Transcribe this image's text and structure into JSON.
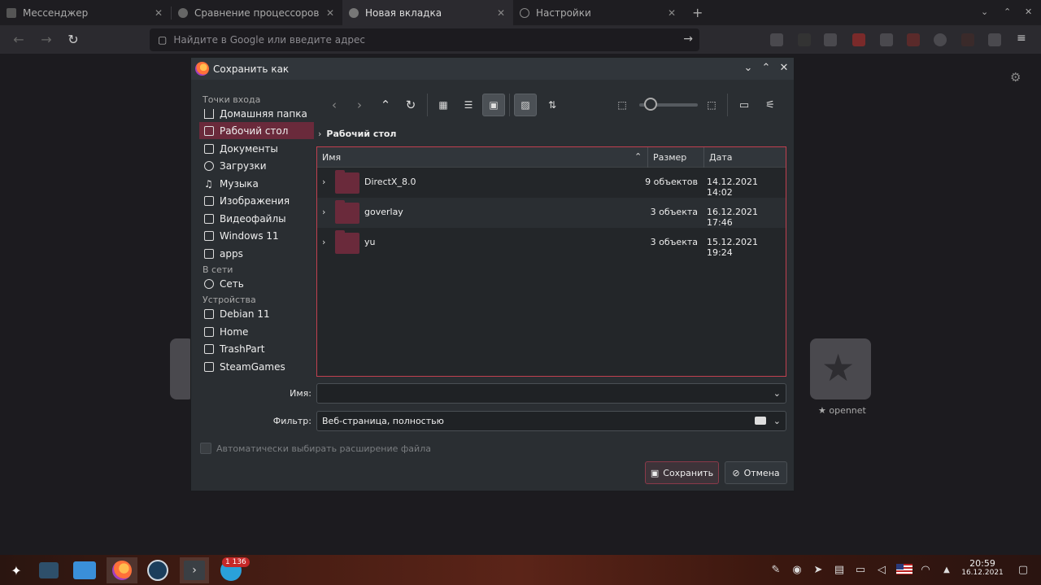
{
  "browser": {
    "tabs": [
      {
        "label": "Мессенджер"
      },
      {
        "label": "Сравнение процессоров"
      },
      {
        "label": "Новая вкладка"
      },
      {
        "label": "Настройки"
      }
    ],
    "url_placeholder": "Найдите в Google или введите адрес"
  },
  "page": {
    "tile_label": "★ opennet"
  },
  "dialog": {
    "title": "Сохранить как",
    "sidebar": {
      "section_places": "Точки входа",
      "places": [
        {
          "label": "Домашняя папка",
          "icon": "home-icon"
        },
        {
          "label": "Рабочий стол",
          "icon": "desktop-icon"
        },
        {
          "label": "Документы",
          "icon": "documents-icon"
        },
        {
          "label": "Загрузки",
          "icon": "downloads-icon"
        },
        {
          "label": "Музыка",
          "icon": "music-icon"
        },
        {
          "label": "Изображения",
          "icon": "pictures-icon"
        },
        {
          "label": "Видеофайлы",
          "icon": "videos-icon"
        },
        {
          "label": "Windows 11",
          "icon": "trash-icon"
        },
        {
          "label": "apps",
          "icon": "folder-icon"
        }
      ],
      "section_network": "В сети",
      "network": [
        {
          "label": "Сеть",
          "icon": "network-icon"
        }
      ],
      "section_devices": "Устройства",
      "devices": [
        {
          "label": "Debian 11",
          "icon": "drive-icon"
        },
        {
          "label": "Home",
          "icon": "drive-icon"
        },
        {
          "label": "TrashPart",
          "icon": "drive-icon"
        },
        {
          "label": "SteamGames",
          "icon": "drive-icon"
        }
      ]
    },
    "breadcrumb": "Рабочий стол",
    "columns": {
      "name": "Имя",
      "size": "Размер",
      "date": "Дата"
    },
    "files": [
      {
        "name": "DirectX_8.0",
        "size": "9 объектов",
        "date": "14.12.2021 14:02"
      },
      {
        "name": "goverlay",
        "size": "3 объекта",
        "date": "16.12.2021 17:46"
      },
      {
        "name": "yu",
        "size": "3 объекта",
        "date": "15.12.2021 19:24"
      }
    ],
    "name_label": "Имя:",
    "name_value": "",
    "filter_label": "Фильтр:",
    "filter_value": "Веб-страница, полностью",
    "auto_ext_label": "Автоматически выбирать расширение файла",
    "save_label": "Сохранить",
    "cancel_label": "Отмена"
  },
  "taskbar": {
    "badge": "1 136",
    "time": "20:59",
    "date": "16.12.2021"
  },
  "colors": {
    "accent": "#6a2a3b",
    "focus_border": "#c0404f",
    "dialog_bg": "#2a2e32"
  }
}
